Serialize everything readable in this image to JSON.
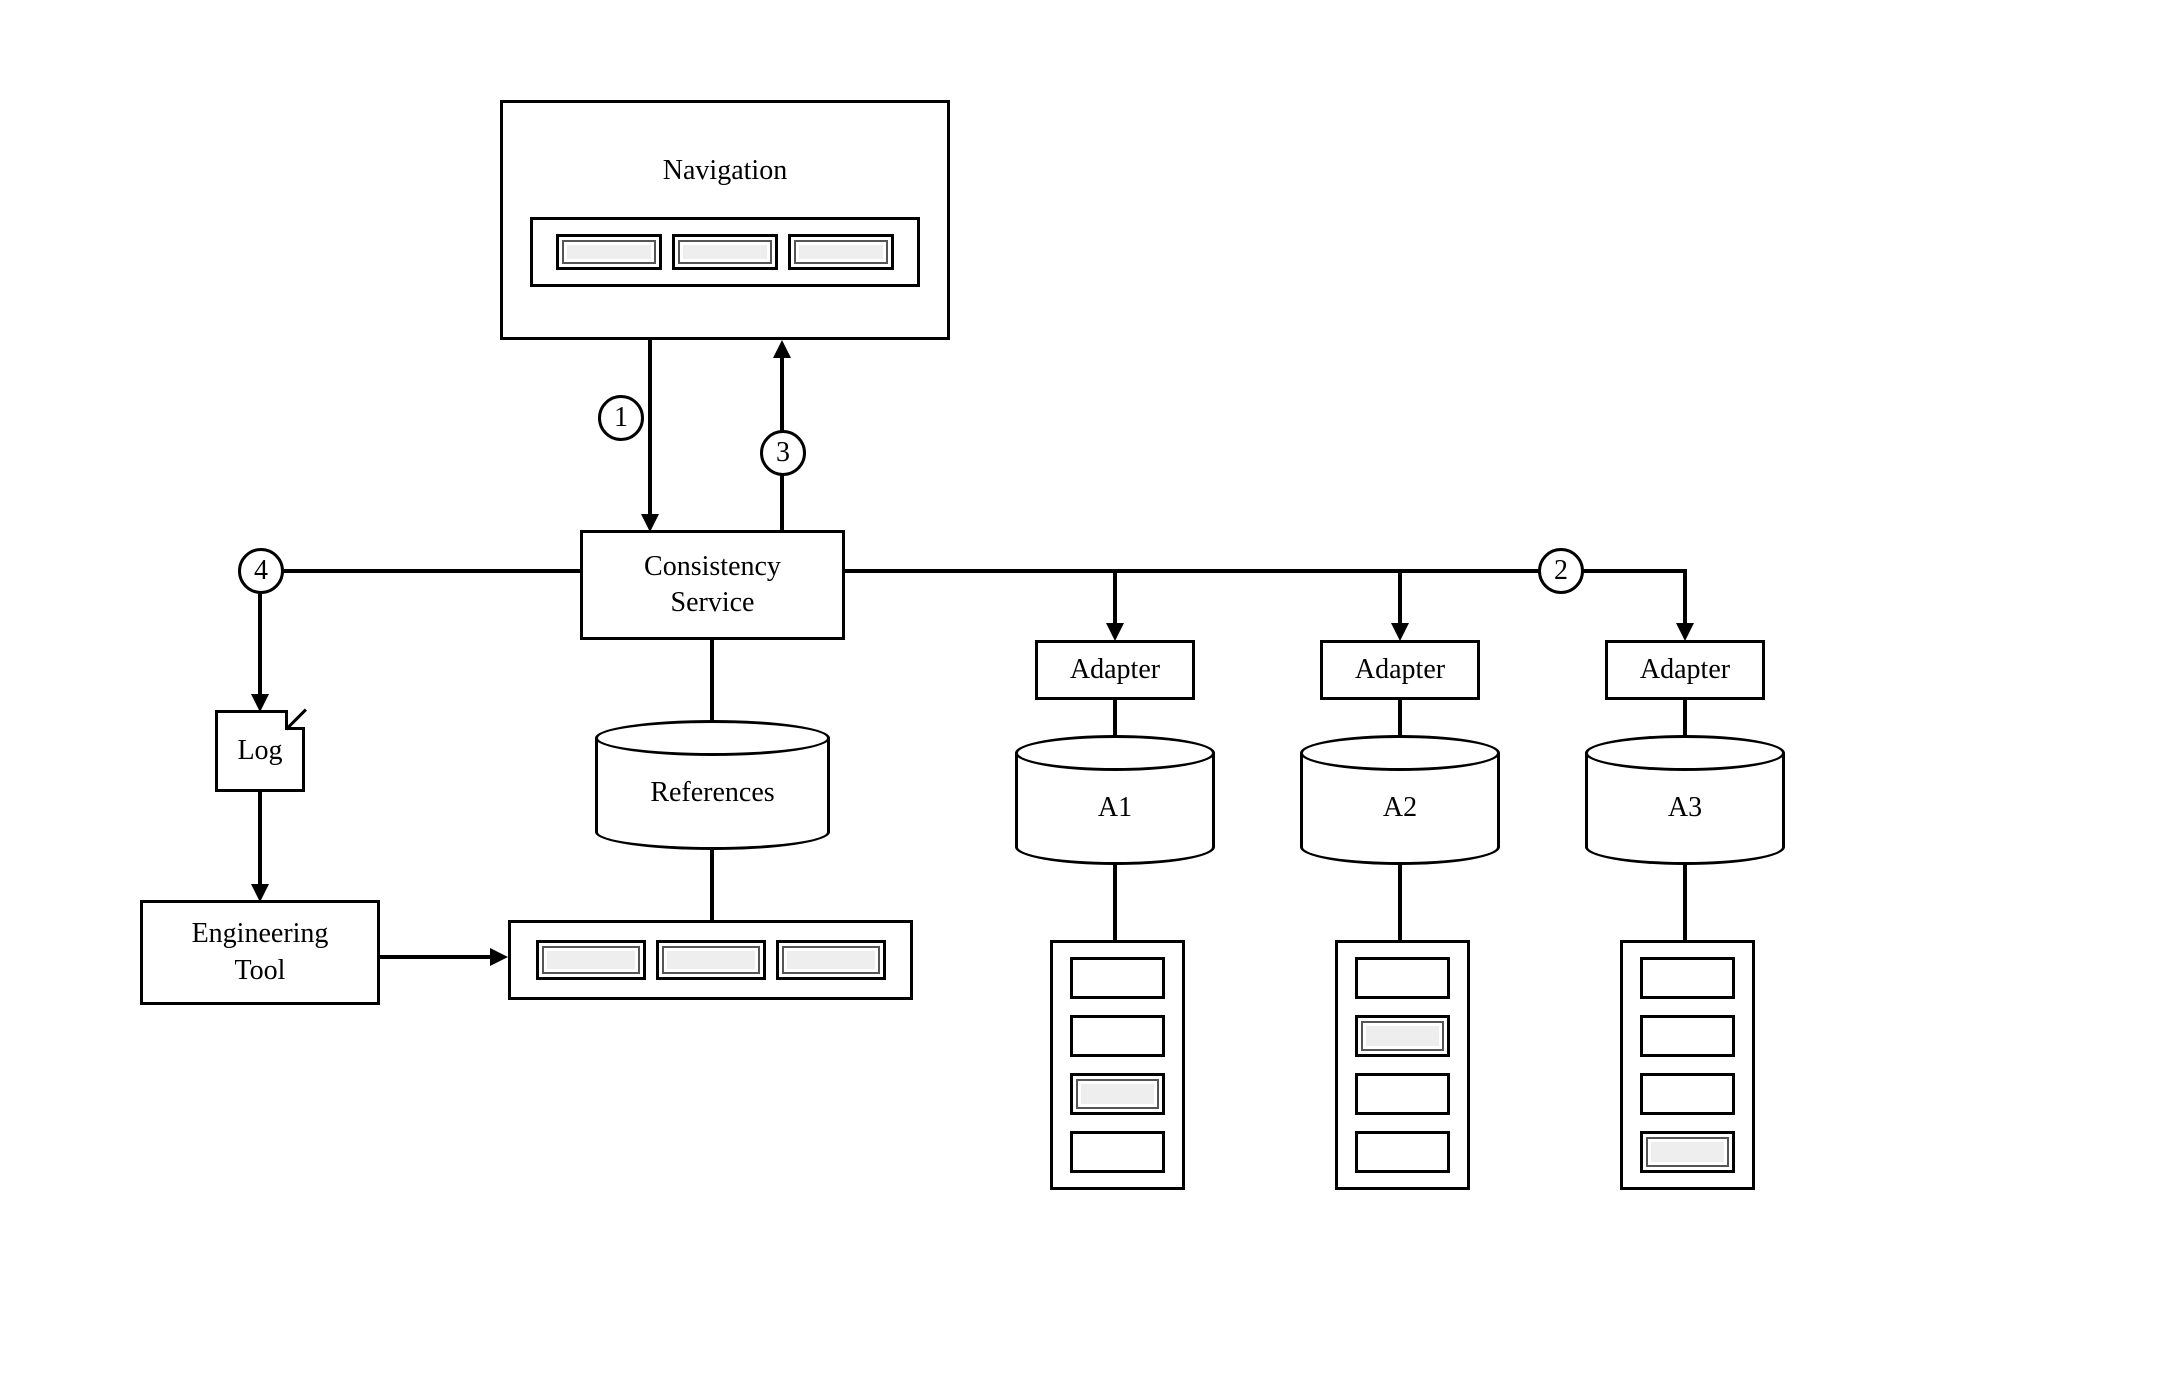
{
  "navigation": {
    "title": "Navigation"
  },
  "consistency": {
    "title": "Consistency\nService"
  },
  "references": {
    "label": "References"
  },
  "log": {
    "label": "Log"
  },
  "engTool": {
    "label": "Engineering\nTool"
  },
  "adapters": {
    "label": "Adapter",
    "items": [
      {
        "db": "A1"
      },
      {
        "db": "A2"
      },
      {
        "db": "A3"
      }
    ]
  },
  "edges": {
    "e1": "1",
    "e2": "2",
    "e3": "3",
    "e4": "4"
  }
}
